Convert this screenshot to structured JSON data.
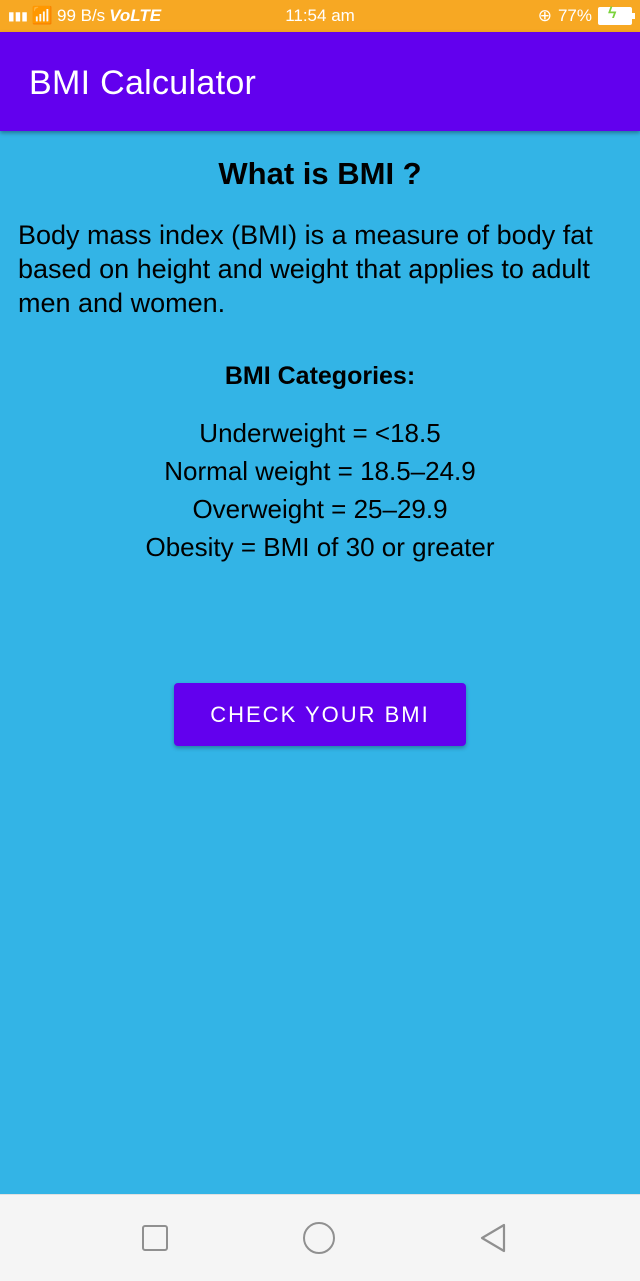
{
  "status_bar": {
    "network": "4G",
    "speed": "99 B/s",
    "volte": "VoLTE",
    "time": "11:54 am",
    "battery": "77%",
    "colors": {
      "background": "#f7a823"
    }
  },
  "app_bar": {
    "title": "BMI Calculator",
    "colors": {
      "background": "#6200ee"
    }
  },
  "main": {
    "heading": "What is BMI ?",
    "intro": "Body mass index (BMI) is a measure of body fat based on height and weight that applies to adult men and women.",
    "categories_heading": "BMI Categories:",
    "categories": [
      "Underweight = <18.5",
      "Normal weight = 18.5–24.9",
      "Overweight = 25–29.9",
      "Obesity = BMI of 30 or greater"
    ],
    "cta_label": "CHECK YOUR BMI",
    "colors": {
      "background": "#33b4e6",
      "button": "#6200ee"
    }
  },
  "nav_bar": {
    "buttons": [
      "recents-icon",
      "home-icon",
      "back-icon"
    ]
  }
}
